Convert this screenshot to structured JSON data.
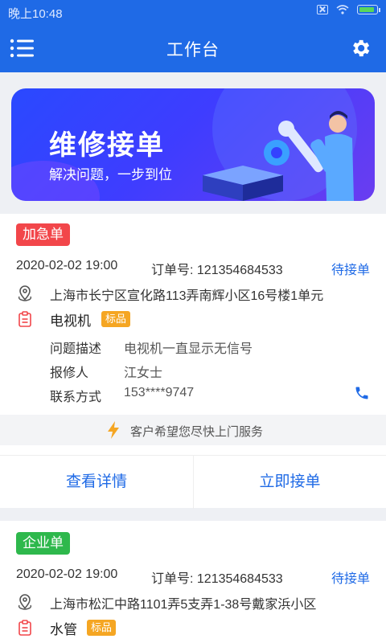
{
  "status_bar": {
    "time": "晚上10:48"
  },
  "header": {
    "title": "工作台"
  },
  "banner": {
    "title": "维修接单",
    "subtitle": "解决问题，一步到位"
  },
  "orders": [
    {
      "tag": "加急单",
      "tag_color": "#f2464a",
      "datetime": "2020-02-02 19:00",
      "order_no": "订单号: 121354684533",
      "status": "待接单",
      "address": "上海市长宁区宣化路113弄南辉小区16号楼1单元",
      "device": "电视机",
      "device_badge": "标品",
      "fields": [
        {
          "key": "问题描述",
          "value": "电视机一直显示无信号"
        },
        {
          "key": "报修人",
          "value": "江女士"
        },
        {
          "key": "联系方式",
          "value": "153****9747"
        }
      ],
      "hint": "客户希望您尽快上门服务",
      "actions": {
        "detail": "查看详情",
        "accept": "立即接单"
      }
    },
    {
      "tag": "企业单",
      "tag_color": "#2eb84c",
      "datetime": "2020-02-02 19:00",
      "order_no": "订单号: 121354684533",
      "status": "待接单",
      "address": "上海市松汇中路1101弄5支弄1-38号戴家浜小区",
      "device": "水管",
      "device_badge": "标品"
    }
  ],
  "colors": {
    "primary": "#1f6ae6",
    "urgent": "#f2464a",
    "enterprise": "#2eb84c",
    "badge": "#f5a623"
  }
}
